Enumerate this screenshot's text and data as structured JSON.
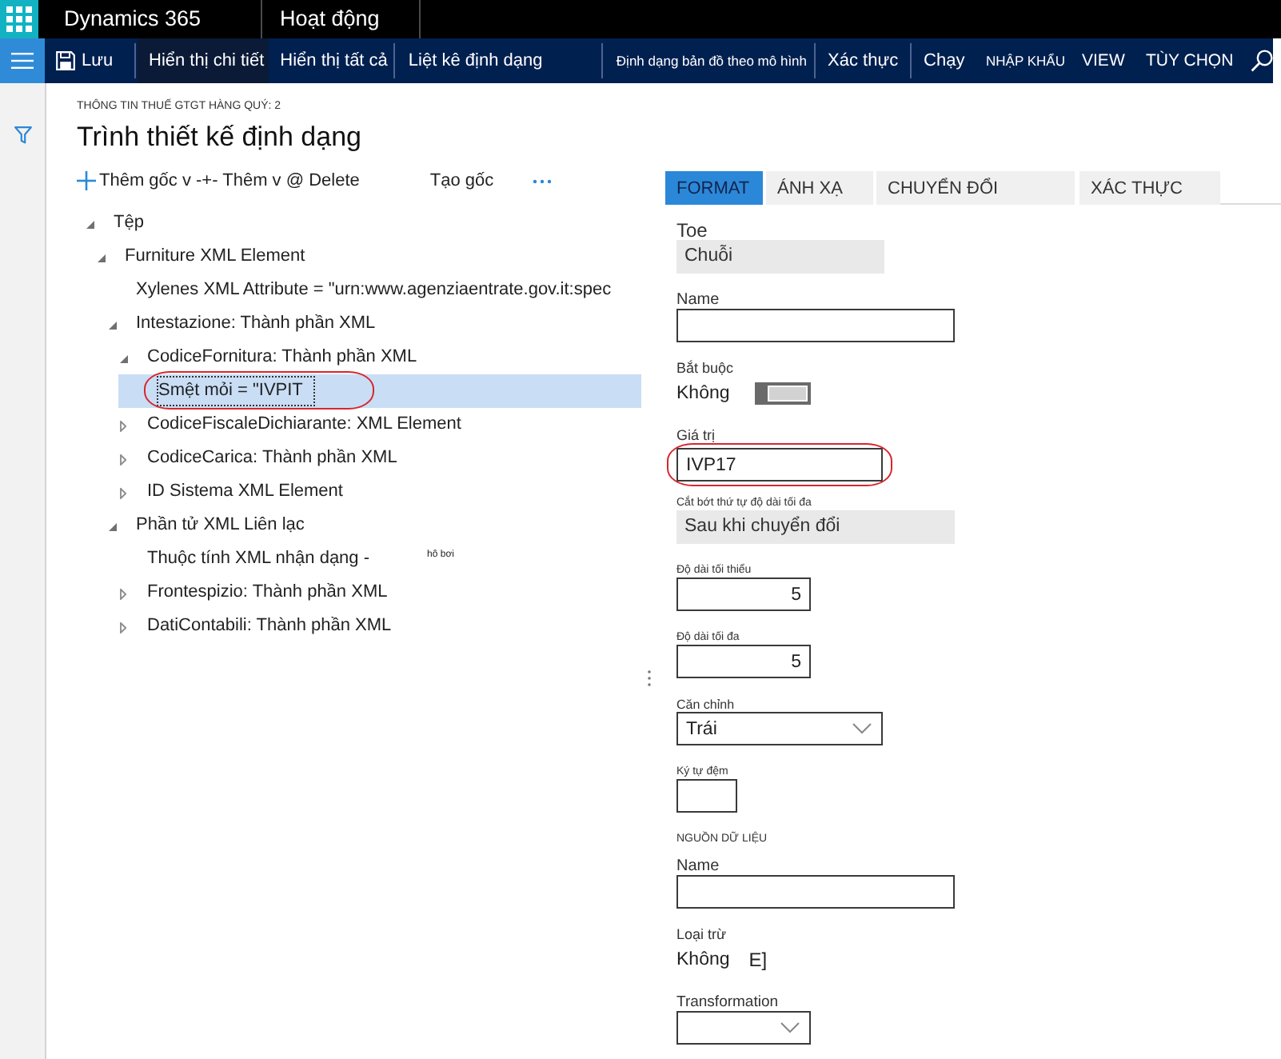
{
  "top_bar": {
    "product": "Dynamics 365",
    "module": "Hoạt động"
  },
  "command_groups": [
    {
      "items": [
        {
          "label": "Lưu",
          "kind": "save",
          "selected": false
        }
      ]
    },
    {
      "items": [
        {
          "label": "Hiển thị chi tiết",
          "kind": "button",
          "selected": true
        },
        {
          "label": "Hiển thị tất cả",
          "kind": "button",
          "selected": false
        }
      ]
    },
    {
      "items": [
        {
          "label": "Liệt kê định dạng",
          "kind": "button",
          "selected": false
        }
      ]
    },
    {
      "items": [
        {
          "label": "Định dạng bản đồ theo mô hình",
          "kind": "compact",
          "selected": false
        }
      ]
    },
    {
      "items": [
        {
          "label": "Xác thực",
          "kind": "button",
          "selected": false
        }
      ]
    },
    {
      "items": [
        {
          "label": "Chạy",
          "kind": "button",
          "selected": false
        },
        {
          "label": "NHẬP KHẨU",
          "kind": "compact",
          "selected": false
        },
        {
          "label": "VIEW",
          "kind": "caps",
          "selected": false
        },
        {
          "label": "TÙY CHỌN",
          "kind": "caps",
          "selected": false
        }
      ]
    }
  ],
  "breadcrumb": "THÔNG TIN THUẾ GTGT HÀNG QUÝ: 2",
  "page_title": "Trình thiết kế định dạng",
  "tree_toolbar": {
    "add_actions": "Thêm gốc v -+- Thêm v @ Delete",
    "create_root": "Tạo gốc"
  },
  "tree": [
    {
      "label": "Tệp",
      "kind": "element",
      "expanded": true,
      "selected": false,
      "annotated": false,
      "children": [
        {
          "label": "Furniture XML Element",
          "kind": "element",
          "expanded": true,
          "selected": false,
          "annotated": false,
          "children": [
            {
              "label": "Xylenes XML Attribute = \"urn:www.agenziaentrate.gov.it:spec",
              "kind": "attribute",
              "selected": false,
              "annotated": false
            },
            {
              "label": "Intestazione: Thành phần XML",
              "kind": "element",
              "expanded": true,
              "selected": false,
              "annotated": false,
              "children": [
                {
                  "label": "CodiceFornitura: Thành phần XML",
                  "kind": "element",
                  "expanded": true,
                  "selected": false,
                  "annotated": false,
                  "children": [
                    {
                      "label": "Smệt mỏi = \"IVPIT",
                      "kind": "attribute",
                      "selected": true,
                      "annotated": true
                    }
                  ]
                },
                {
                  "label": "CodiceFiscaleDichiarante: XML Element",
                  "kind": "element",
                  "expanded": false,
                  "selected": false,
                  "annotated": false
                },
                {
                  "label": "CodiceCarica: Thành phần XML",
                  "kind": "element",
                  "expanded": false,
                  "selected": false,
                  "annotated": false
                },
                {
                  "label": "ID Sistema XML Element",
                  "kind": "element",
                  "expanded": false,
                  "selected": false,
                  "annotated": false
                }
              ]
            },
            {
              "label": "Phần tử XML Liên lạc",
              "kind": "element",
              "expanded": true,
              "selected": false,
              "annotated": false,
              "children": [
                {
                  "label": "Thuộc tính XML nhận dạng -",
                  "kind": "attribute",
                  "selected": false,
                  "annotated": false,
                  "note": "hô bơi"
                },
                {
                  "label": "Frontespizio: Thành phần XML",
                  "kind": "element",
                  "expanded": false,
                  "selected": false,
                  "annotated": false
                },
                {
                  "label": "DatiContabili: Thành phần XML",
                  "kind": "element",
                  "expanded": false,
                  "selected": false,
                  "annotated": false
                }
              ]
            }
          ]
        }
      ]
    }
  ],
  "tabs": [
    {
      "label": "FORMAT",
      "selected": true
    },
    {
      "label": "ÁNH XẠ",
      "selected": false
    },
    {
      "label": "CHUYỂN ĐỔI",
      "selected": false
    },
    {
      "label": "XÁC THỰC",
      "selected": false
    }
  ],
  "format_fields": [
    {
      "kind": "readonly",
      "label": "Toe",
      "value": "Chuỗi",
      "annotated": false
    },
    {
      "kind": "text",
      "label": "Name",
      "annotated": false
    },
    {
      "kind": "toggle",
      "label": "Bắt buộc",
      "value": "Không",
      "on": false,
      "annotated": false
    },
    {
      "kind": "text",
      "label": "Giá trị",
      "value": "IVP17",
      "annotated": true
    },
    {
      "kind": "readonly",
      "label": "Cắt bớt thứ tự độ dài tối đa",
      "value": "Sau khi chuyển đổi",
      "annotated": false
    },
    {
      "kind": "number",
      "label": "Độ dài tối thiểu",
      "value": "5",
      "annotated": false
    },
    {
      "kind": "number",
      "label": "Độ dài tối đa",
      "value": "5",
      "annotated": false
    },
    {
      "kind": "dropdown",
      "label": "Căn chỉnh",
      "value": "Trái",
      "annotated": false
    },
    {
      "kind": "text",
      "label": "Ký tự đệm",
      "annotated": false
    },
    {
      "kind": "section",
      "label": "NGUỒN DỮ LIỆU",
      "annotated": false
    },
    {
      "kind": "text",
      "label": "Name",
      "annotated": false
    },
    {
      "kind": "glyph_toggle",
      "label": "Loại trừ",
      "value": "Không",
      "glyph": "E]",
      "annotated": false
    },
    {
      "kind": "dropdown",
      "label": "Transformation",
      "annotated": false
    }
  ]
}
